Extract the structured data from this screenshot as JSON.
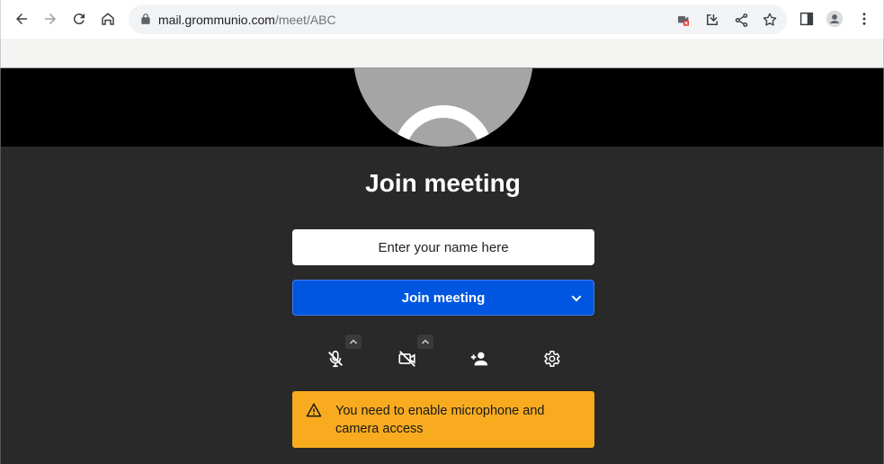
{
  "browser": {
    "url_domain": "mail.grommunio.com",
    "url_path": "/meet/ABC"
  },
  "meeting": {
    "title": "Join meeting",
    "name_placeholder": "Enter your name here",
    "join_button_label": "Join meeting",
    "warning_text": "You need to enable microphone and camera access",
    "colors": {
      "panel_bg": "#292929",
      "join_button": "#0056e0",
      "warning_bg": "#f8ab1f",
      "avatar": "#a5a5a5"
    },
    "icons": [
      "mic-off-icon",
      "video-off-icon",
      "add-person-icon",
      "settings-icon",
      "warning-icon"
    ]
  }
}
